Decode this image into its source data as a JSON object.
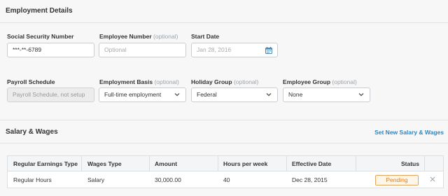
{
  "employment": {
    "title": "Employment Details",
    "ssn": {
      "label": "Social Security Number",
      "value": "***-**-6789"
    },
    "employee_number": {
      "label": "Employee Number",
      "optional": "(optional)",
      "placeholder": "Optional"
    },
    "start_date": {
      "label": "Start Date",
      "placeholder": "Jan 28, 2016",
      "icon": "calendar-icon"
    },
    "payroll_schedule": {
      "label": "Payroll Schedule",
      "value": "Payroll Schedule, not setup"
    },
    "employment_basis": {
      "label": "Employment Basis",
      "optional": "(optional)",
      "value": "Full-time employment"
    },
    "holiday_group": {
      "label": "Holiday Group",
      "optional": "(optional)",
      "value": "Federal"
    },
    "employee_group": {
      "label": "Employee Group",
      "optional": "(optional)",
      "value": "None"
    }
  },
  "salary": {
    "title": "Salary & Wages",
    "new_link": "Set New Salary & Wages",
    "columns": [
      "Regular Earnings Type",
      "Wages Type",
      "Amount",
      "Hours per week",
      "Effective Date",
      "Status"
    ],
    "rows": [
      {
        "earnings_type": "Regular Hours",
        "wages_type": "Salary",
        "amount": "30,000.00",
        "hours": "40",
        "effective_date": "Dec 28, 2015",
        "status": "Pending",
        "remove_icon": "close-icon"
      }
    ]
  },
  "colors": {
    "link": "#2a86c5",
    "pending_border": "#e8a35b",
    "pending_text": "#e07d18"
  }
}
